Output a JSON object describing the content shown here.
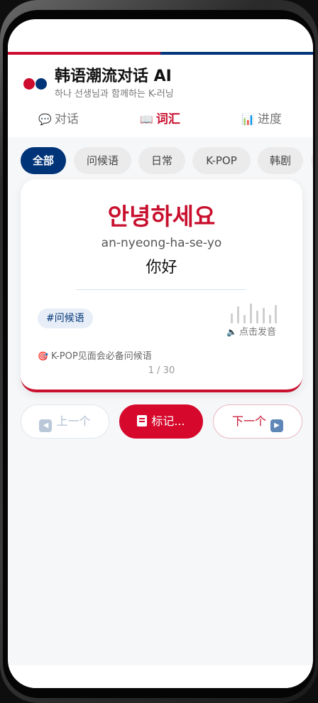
{
  "app": {
    "title": "韩语潮流对话 AI",
    "subtitle": "하나 선생님과 함께하는 K-러닝"
  },
  "tabs": [
    {
      "label": "对话",
      "icon": "speech-bubble-icon",
      "active": false
    },
    {
      "label": "词汇",
      "icon": "book-icon",
      "active": true
    },
    {
      "label": "进度",
      "icon": "bar-chart-icon",
      "active": false
    }
  ],
  "categories": [
    {
      "label": "全部",
      "active": true
    },
    {
      "label": "问候语",
      "active": false
    },
    {
      "label": "日常",
      "active": false
    },
    {
      "label": "K-POP",
      "active": false
    },
    {
      "label": "韩剧",
      "active": false
    }
  ],
  "card": {
    "korean": "안녕하세요",
    "romanization": "an-nyeong-ha-se-yo",
    "chinese": "你好",
    "tag": "#问候语",
    "speak_label": "点击发音",
    "note": "K-POP见面会必备问候语",
    "counter": "1 / 30"
  },
  "buttons": {
    "prev": "上一个",
    "mark": "标记...",
    "next": "下一个"
  },
  "colors": {
    "accent_red": "#c8102e",
    "accent_blue": "#003478",
    "background": "#f6f7f9"
  }
}
